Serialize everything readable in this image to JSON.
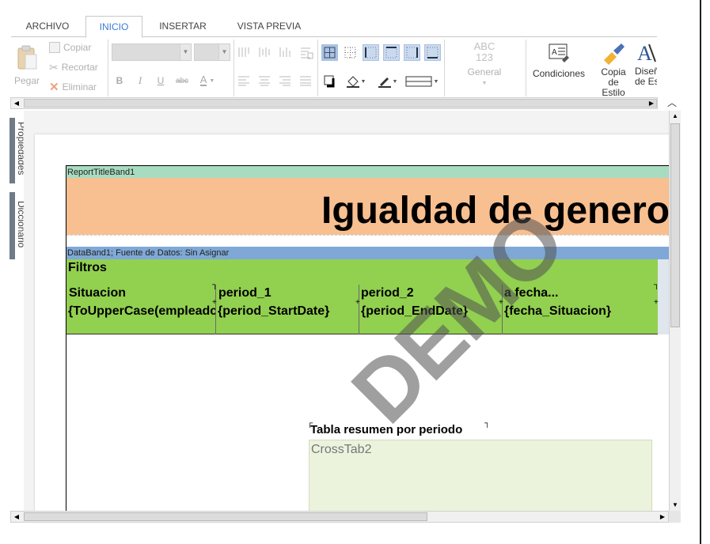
{
  "tabs": [
    "ARCHIVO",
    "INICIO",
    "INSERTAR",
    "VISTA PREVIA"
  ],
  "active_tab": "INICIO",
  "clipboard": {
    "paste": "Pegar",
    "copy": "Copiar",
    "cut": "Recortar",
    "delete": "Eliminar"
  },
  "number_format": {
    "sample": "ABC\n123",
    "sample_top": "ABC",
    "sample_bottom": "123",
    "label": "General"
  },
  "ribbon_buttons": {
    "conditions": "Condiciones",
    "copy_style": "Copia de Estilo",
    "copy_style_l1": "Copia",
    "copy_style_l2": "de",
    "copy_style_l3": "Estilo",
    "design": "Diseño de Es",
    "design_l1": "Diseñ",
    "design_l2": "de Es"
  },
  "side_panels": [
    "Propiedades",
    "Diccionario"
  ],
  "report": {
    "title_band_name": "ReportTitleBand1",
    "title": "Igualdad de genero",
    "data_band_name": "DataBand1; Fuente de Datos: Sin Asignar",
    "filters_label": "Filtros",
    "columns": [
      {
        "header": "Situacion",
        "value": "{ToUpperCase(empleadc"
      },
      {
        "header": "period_1",
        "value": "{period_StartDate}"
      },
      {
        "header": "period_2",
        "value": "{period_EndDate}"
      },
      {
        "header": "a fecha...",
        "value": "{fecha_Situacion}"
      }
    ],
    "crosstab_title": "Tabla resumen por periodo",
    "crosstab_name": "CrossTab2",
    "watermark": "DEMO"
  },
  "colors": {
    "accent": "#3a7bd5",
    "title_band": "#f8bf90",
    "band_header_green": "#a8dcc0",
    "band_header_blue": "#7fa8d6",
    "data_band": "#92d050",
    "crosstab": "#ebf3dd"
  }
}
